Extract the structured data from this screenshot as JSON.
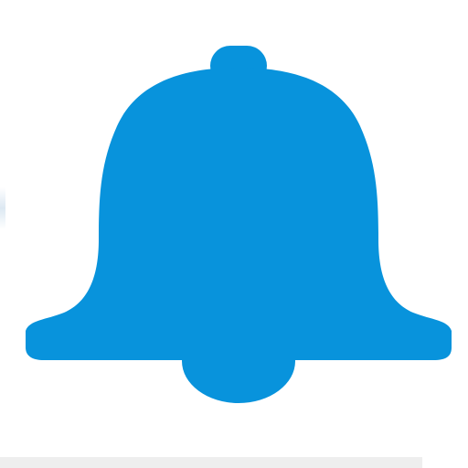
{
  "icon": {
    "name": "bell-icon",
    "color": "#0893dc"
  },
  "background_color": "#ffffff",
  "strip_color": "#eeeeee"
}
